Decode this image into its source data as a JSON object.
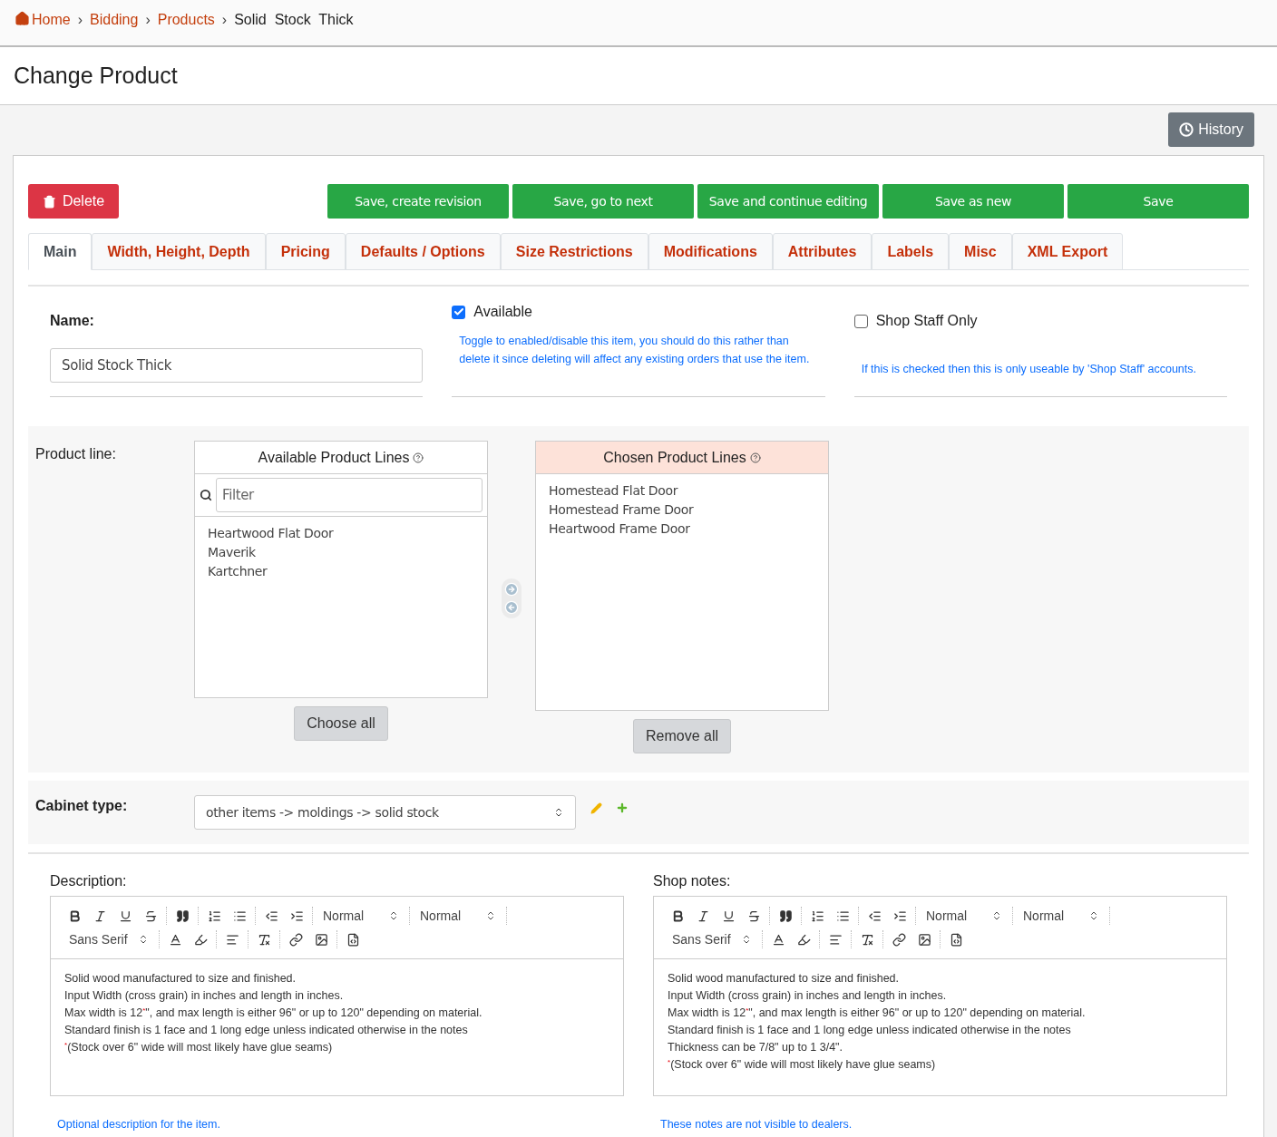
{
  "breadcrumb_separator": "›",
  "breadcrumb": [
    {
      "label": "Home",
      "link": true
    },
    {
      "label": "Bidding",
      "link": true
    },
    {
      "label": "Products",
      "link": true
    },
    {
      "label": "Solid  Stock  Thick",
      "link": false
    }
  ],
  "page_title": "Change Product",
  "history_button": "History",
  "delete_button": "Delete",
  "save_buttons": [
    "Save, create revision",
    "Save, go to next",
    "Save and continue editing",
    "Save as new",
    "Save"
  ],
  "tabs": [
    {
      "label": "Main",
      "selected": true
    },
    {
      "label": "Width, Height, Depth",
      "selected": false
    },
    {
      "label": "Pricing",
      "selected": false
    },
    {
      "label": "Defaults / Options",
      "selected": false
    },
    {
      "label": "Size Restrictions",
      "selected": false
    },
    {
      "label": "Modifications",
      "selected": false
    },
    {
      "label": "Attributes",
      "selected": false
    },
    {
      "label": "Labels",
      "selected": false
    },
    {
      "label": "Misc",
      "selected": false
    },
    {
      "label": "XML Export",
      "selected": false
    }
  ],
  "name": {
    "label": "Name:",
    "value": "Solid Stock Thick"
  },
  "available": {
    "label": "Available",
    "checked": true,
    "help": "Toggle to enabled/disable this item, you should do this rather than delete it since deleting will affect any existing orders that use the item."
  },
  "shop_staff_only": {
    "label": "Shop Staff Only",
    "checked": false,
    "help": "If this is checked then this is only useable by 'Shop Staff' accounts."
  },
  "product_line": {
    "label": "Product line:",
    "available": {
      "title": "Available Product Lines",
      "filter_placeholder": "Filter",
      "items": [
        "Heartwood Flat Door",
        "Maverik",
        "Kartchner"
      ],
      "button": "Choose all"
    },
    "chosen": {
      "title": "Chosen Product Lines",
      "items": [
        "Homestead Flat Door",
        "Homestead Frame Door",
        "Heartwood Frame Door"
      ],
      "button": "Remove all"
    }
  },
  "cabinet_type": {
    "label": "Cabinet type:",
    "value": "other items -> moldings -> solid stock"
  },
  "editors": [
    {
      "label": "Description:",
      "toolbar": {
        "header": "Normal",
        "size": "Normal",
        "font": "Sans Serif"
      },
      "lines": [
        "Solid wood manufactured to size and finished.",
        "Input Width (cross grain) in inches and length in inches.",
        "Max width is 12$^{*}$\", and max length is either 96\" or up to 120\" depending on material.",
        "Standard finish is 1 face and 1 long edge unless indicated otherwise in the notes",
        "$^{*}$(Stock over 6\" wide will most likely have glue seams)"
      ],
      "help": "Optional description for the item."
    },
    {
      "label": "Shop notes:",
      "toolbar": {
        "header": "Normal",
        "size": "Normal",
        "font": "Sans Serif"
      },
      "lines": [
        "Solid wood manufactured to size and finished.",
        "Input Width (cross grain) in inches and length in inches.",
        "Max width is 12$^{*}$\", and max length is either 96\" or up to 120\" depending on material.",
        "Standard finish is 1 face and 1 long edge unless indicated otherwise in the notes",
        "Thickness can be 7/8\" up to 1 3/4\".",
        "$^{*}$(Stock over 6\" wide will most likely have glue seams)"
      ],
      "help": "These notes are not visible to dealers."
    }
  ]
}
